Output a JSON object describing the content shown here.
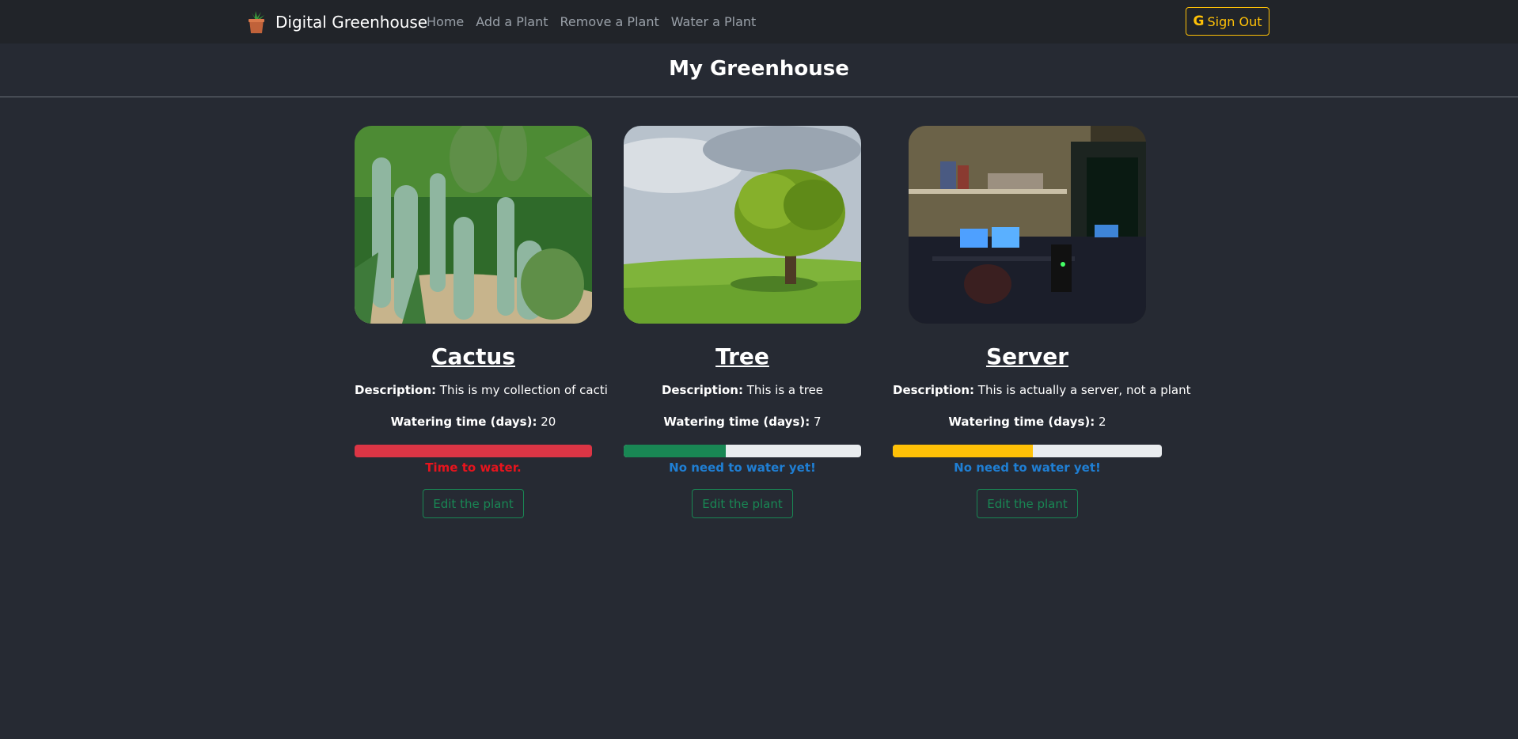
{
  "navbar": {
    "brand": "Digital Greenhouse",
    "brand_icon": "potted-plant-icon",
    "links": [
      "Home",
      "Add a Plant",
      "Remove a Plant",
      "Water a Plant"
    ],
    "signout_label": "Sign Out",
    "signout_icon": "google-icon",
    "signout_color": "#ffc107"
  },
  "page": {
    "title": "My Greenhouse"
  },
  "labels": {
    "description": "Description:",
    "watering": "Watering time (days):",
    "edit": "Edit the plant"
  },
  "plants": [
    {
      "name": "Cactus",
      "description": "This is my collection of cacti",
      "watering_days": "20",
      "progress": 1.0,
      "bar_color": "#dc3545",
      "status": "Time to water.",
      "status_color": "#e8141d"
    },
    {
      "name": "Tree",
      "description": "This is a tree",
      "watering_days": "7",
      "progress": 0.43,
      "bar_color": "#198754",
      "status": "No need to water yet!",
      "status_color": "#1f7fd4"
    },
    {
      "name": "Server",
      "description": "This is actually a server, not a plant",
      "watering_days": "2",
      "progress": 0.52,
      "bar_color": "#ffc107",
      "status": "No need to water yet!",
      "status_color": "#1f7fd4"
    }
  ]
}
